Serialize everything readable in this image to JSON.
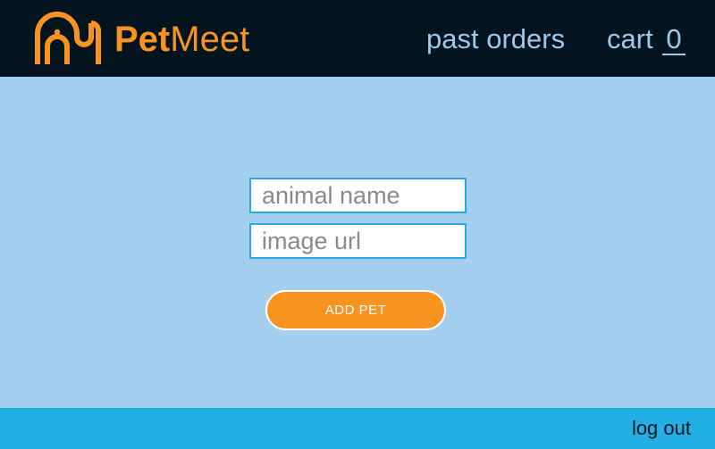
{
  "brand": {
    "part1": "Pet",
    "part2": "Meet",
    "color": "#f7931e"
  },
  "nav": {
    "past_orders": "past orders",
    "cart_label": "cart",
    "cart_count": "0"
  },
  "form": {
    "animal_name_placeholder": "animal name",
    "image_url_placeholder": "image url",
    "add_button_label": "ADD PET"
  },
  "footer": {
    "logout_label": "log out"
  },
  "colors": {
    "header_bg": "#03141f",
    "page_bg": "#a4cfee",
    "footer_bg": "#22b0e4",
    "accent": "#f7931e",
    "nav_text": "#9bcbec"
  },
  "icons": {
    "logo": "elephant-logo-icon"
  }
}
